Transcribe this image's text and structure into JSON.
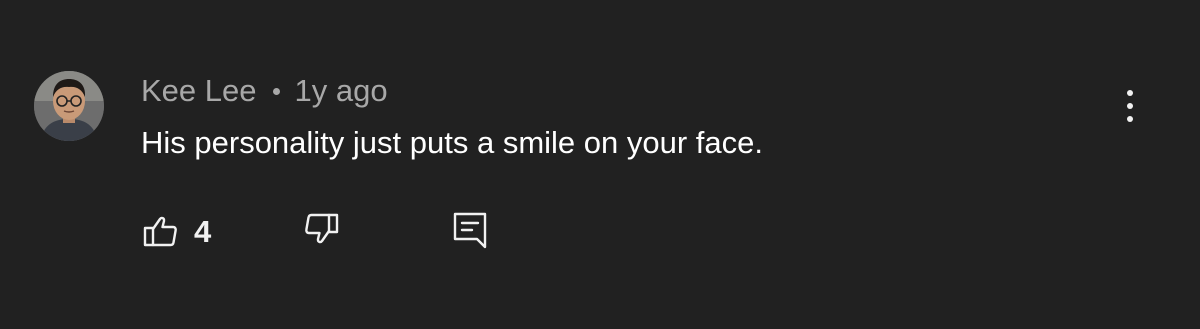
{
  "comment": {
    "author": "Kee Lee",
    "time": "1y ago",
    "text": "His personality just puts a smile on your face.",
    "like_count": "4"
  },
  "icons": {
    "like": "thumbs-up-icon",
    "dislike": "thumbs-down-icon",
    "reply": "reply-comment-icon",
    "more": "more-vertical-icon"
  },
  "colors": {
    "background": "#212121",
    "author_meta": "#a8a8a8",
    "text": "#ffffff",
    "icon": "#f1f1f1"
  }
}
